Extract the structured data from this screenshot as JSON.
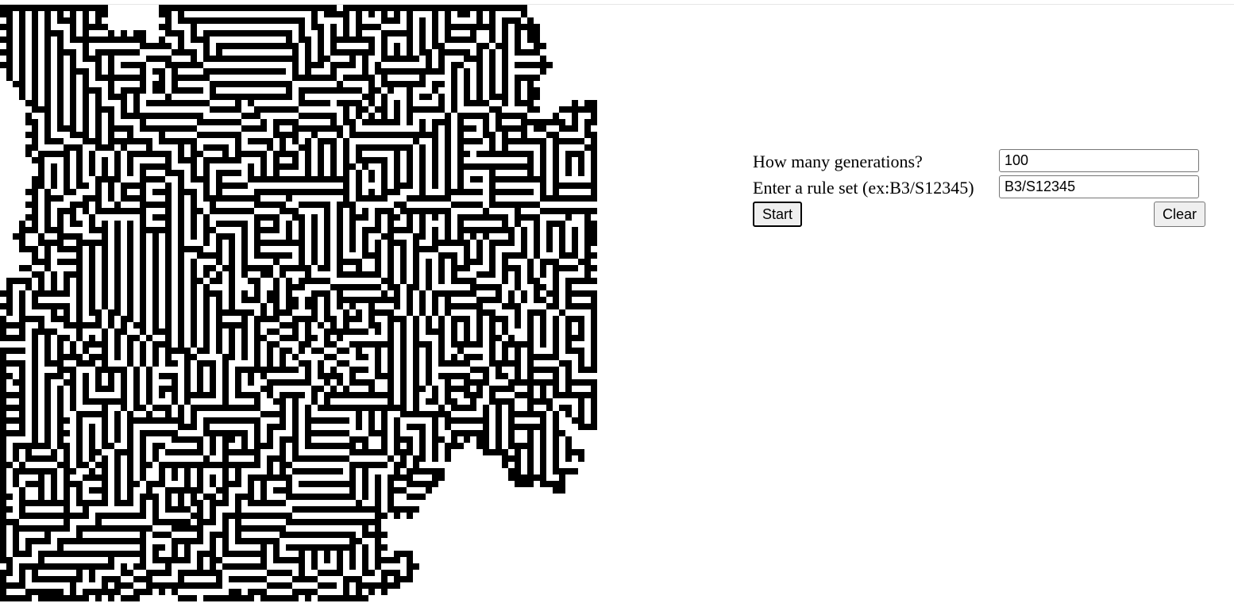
{
  "form": {
    "generations_label": "How many generations?",
    "generations_value": "100",
    "rule_label": "Enter a rule set (ex:B3/S12345)",
    "rule_value": "B3/S12345",
    "start_label": "Start",
    "clear_label": "Clear"
  },
  "colors": {
    "live_cell": "#000000",
    "dead_cell": "#ffffff"
  }
}
